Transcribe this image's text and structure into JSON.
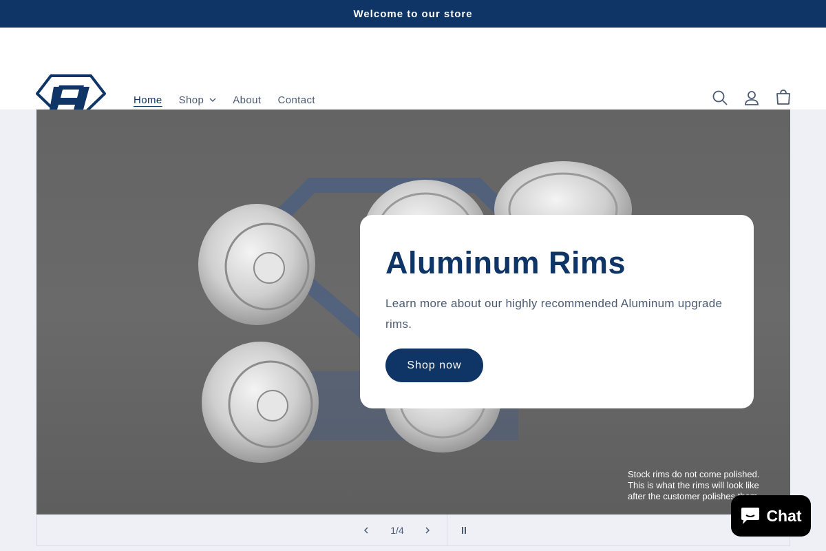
{
  "announcement": {
    "text": "Welcome to our store"
  },
  "header": {
    "nav": [
      {
        "label": "Home",
        "active": true
      },
      {
        "label": "Shop",
        "has_dropdown": true
      },
      {
        "label": "About"
      },
      {
        "label": "Contact"
      }
    ],
    "icons": [
      "search-icon",
      "account-icon",
      "cart-icon"
    ]
  },
  "hero": {
    "heading": "Aluminum Rims",
    "text": "Learn more about our highly recommended Aluminum upgrade rims.",
    "button_label": "Shop now",
    "note_lines": [
      "Stock rims do not come polished.",
      "This is what the rims will look like",
      "after the customer polishes them"
    ]
  },
  "slider": {
    "counter": "1/4",
    "current": 1,
    "total": 4
  },
  "chat": {
    "label": "Chat"
  },
  "colors": {
    "brand": "#0f3566",
    "page_bg": "#eef0f6",
    "chat_bg": "#000000"
  }
}
